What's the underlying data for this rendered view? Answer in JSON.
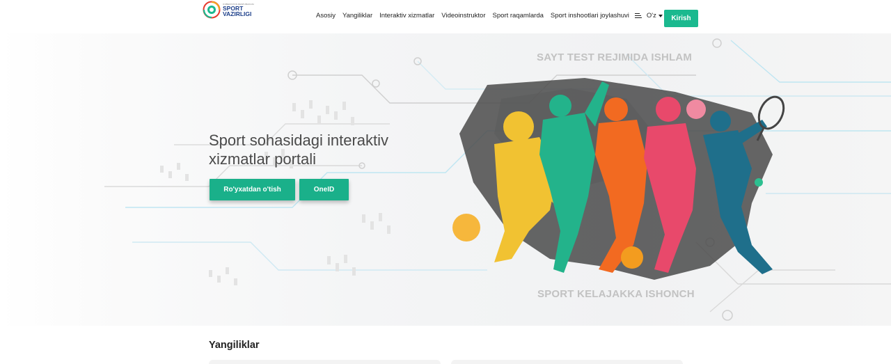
{
  "brand": {
    "small_text": "O'ZBEKISTON RESPUBLIKASI",
    "name_line1": "SPORT",
    "name_line2": "VAZIRLIGI",
    "colors": {
      "green": "#1bb98f",
      "navy": "#1d3f8a"
    }
  },
  "nav": {
    "items": [
      {
        "label": "Asosiy"
      },
      {
        "label": "Yangiliklar"
      },
      {
        "label": "Interaktiv xizmatlar"
      },
      {
        "label": "Videoinstruktor"
      },
      {
        "label": "Sport raqamlarda"
      },
      {
        "label": "Sport inshootlari joylashuvi"
      }
    ],
    "menu_icon": "menu-icon",
    "language": "O'z",
    "login_label": "Kirish"
  },
  "hero": {
    "test_notice": "SAYT TEST REJIMIDA ISHLAM",
    "title_line1": "Sport sohasidagi interaktiv",
    "title_line2": "xizmatlar portali",
    "register_label": "Ro'yxatdan o'tish",
    "oneid_label": "OneID",
    "slogan": "SPORT KELAJAKKA ISHONCH",
    "accent_color": "#1ab08a"
  },
  "news": {
    "title": "Yangiliklar"
  }
}
